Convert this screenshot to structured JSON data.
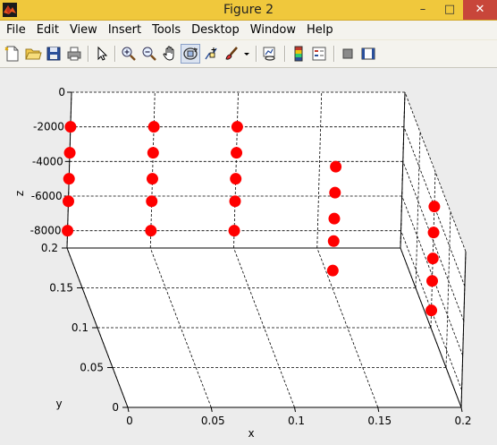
{
  "window": {
    "title": "Figure 2",
    "minimize_icon": "minimize-icon",
    "maximize_icon": "maximize-icon",
    "close_icon": "close-icon"
  },
  "menu": {
    "items": [
      "File",
      "Edit",
      "View",
      "Insert",
      "Tools",
      "Desktop",
      "Window",
      "Help"
    ]
  },
  "toolbar": {
    "buttons": [
      {
        "name": "new-figure-button",
        "icon": "new-document-icon"
      },
      {
        "name": "open-file-button",
        "icon": "folder-open-icon"
      },
      {
        "name": "save-figure-button",
        "icon": "floppy-disk-icon"
      },
      {
        "name": "print-figure-button",
        "icon": "printer-icon"
      },
      {
        "name": "edit-plot-button",
        "icon": "arrow-pointer-icon"
      },
      {
        "name": "zoom-in-button",
        "icon": "zoom-in-icon"
      },
      {
        "name": "zoom-out-button",
        "icon": "zoom-out-icon"
      },
      {
        "name": "pan-button",
        "icon": "hand-icon"
      },
      {
        "name": "rotate-3d-button",
        "icon": "rotate-3d-icon",
        "pressed": true
      },
      {
        "name": "data-cursor-button",
        "icon": "data-cursor-icon"
      },
      {
        "name": "brush-button",
        "icon": "brush-icon"
      },
      {
        "name": "brush-dropdown-button",
        "icon": "chevron-down-icon"
      },
      {
        "name": "link-plot-button",
        "icon": "link-plot-icon"
      },
      {
        "name": "insert-colorbar-button",
        "icon": "colorbar-icon"
      },
      {
        "name": "insert-legend-button",
        "icon": "legend-icon"
      },
      {
        "name": "hide-plot-tools-button",
        "icon": "hide-tools-icon"
      },
      {
        "name": "show-plot-tools-button",
        "icon": "show-tools-icon"
      }
    ]
  },
  "colors": {
    "marker": "#ff0000",
    "titlebar": "#f0c83c",
    "axes_background": "#ffffff"
  },
  "chart_data": {
    "type": "scatter",
    "projection": "3d",
    "title": "",
    "xlabel": "x",
    "ylabel": "y",
    "zlabel": "z",
    "xlim": [
      0,
      0.2
    ],
    "ylim": [
      0,
      0.2
    ],
    "zlim": [
      -9000,
      0
    ],
    "xticks": [
      0,
      0.05,
      0.1,
      0.15,
      0.2
    ],
    "xticklabels": [
      "0",
      "0.05",
      "0.1",
      "0.15",
      "0.2"
    ],
    "yticks": [
      0,
      0.05,
      0.1,
      0.15,
      0.2
    ],
    "yticklabels": [
      "0",
      "0.05",
      "0.1",
      "0.15",
      "0.2"
    ],
    "zticks": [
      -8000,
      -6000,
      -4000,
      -2000,
      0
    ],
    "zticklabels": [
      "-8000",
      "-6000",
      "-4000",
      "-2000",
      "0"
    ],
    "grid": true,
    "marker": "filled-circle",
    "series": [
      {
        "values": [
          {
            "x": 0.0,
            "y": 0.2,
            "z": -2000
          },
          {
            "x": 0.0,
            "y": 0.2,
            "z": -3500
          },
          {
            "x": 0.0,
            "y": 0.2,
            "z": -5000
          },
          {
            "x": 0.0,
            "y": 0.2,
            "z": -6300
          },
          {
            "x": 0.0,
            "y": 0.2,
            "z": -8000
          },
          {
            "x": 0.05,
            "y": 0.2,
            "z": -2000
          },
          {
            "x": 0.05,
            "y": 0.2,
            "z": -3500
          },
          {
            "x": 0.05,
            "y": 0.2,
            "z": -5000
          },
          {
            "x": 0.05,
            "y": 0.2,
            "z": -6300
          },
          {
            "x": 0.05,
            "y": 0.2,
            "z": -8000
          },
          {
            "x": 0.1,
            "y": 0.2,
            "z": -2000
          },
          {
            "x": 0.1,
            "y": 0.2,
            "z": -3500
          },
          {
            "x": 0.1,
            "y": 0.2,
            "z": -5000
          },
          {
            "x": 0.1,
            "y": 0.2,
            "z": -6300
          },
          {
            "x": 0.1,
            "y": 0.2,
            "z": -8000
          },
          {
            "x": 0.15,
            "y": 0.15,
            "z": -2000
          },
          {
            "x": 0.15,
            "y": 0.15,
            "z": -3500
          },
          {
            "x": 0.15,
            "y": 0.15,
            "z": -5000
          },
          {
            "x": 0.15,
            "y": 0.15,
            "z": -6300
          },
          {
            "x": 0.15,
            "y": 0.15,
            "z": -8000
          },
          {
            "x": 0.2,
            "y": 0.1,
            "z": -2000
          },
          {
            "x": 0.2,
            "y": 0.1,
            "z": -3500
          },
          {
            "x": 0.2,
            "y": 0.1,
            "z": -5000
          },
          {
            "x": 0.2,
            "y": 0.1,
            "z": -6300
          },
          {
            "x": 0.2,
            "y": 0.1,
            "z": -8000
          }
        ]
      }
    ]
  }
}
